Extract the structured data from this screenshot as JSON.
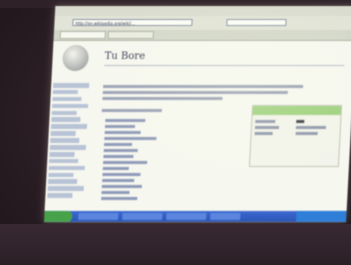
{
  "browser": {
    "address": "http://en.wikipedia.org/wiki/...",
    "tabs": [
      "",
      ""
    ]
  },
  "article": {
    "title": "Tu Bore"
  }
}
